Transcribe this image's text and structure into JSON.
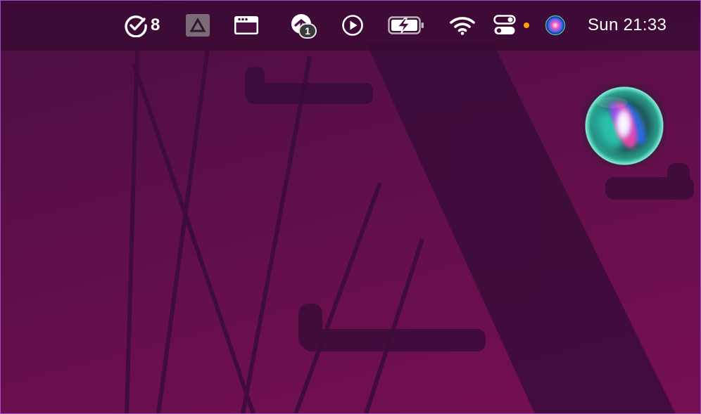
{
  "menubar": {
    "tasks": {
      "icon": "checkmark-circle-icon",
      "count": "8"
    },
    "items": [
      {
        "name": "drive-icon"
      },
      {
        "name": "window-icon"
      },
      {
        "name": "upload-cloud-icon",
        "badge": "1"
      },
      {
        "name": "play-icon"
      },
      {
        "name": "battery-charging-icon"
      },
      {
        "name": "wifi-icon"
      },
      {
        "name": "control-center-icon"
      },
      {
        "name": "siri-icon"
      }
    ],
    "status_dot_color": "#ff9f0a",
    "clock": "Sun 21:33"
  },
  "siri": {
    "state": "listening",
    "colors": [
      "#3be0c8",
      "#2a7bff",
      "#ff3fa8",
      "#ffffff"
    ]
  },
  "wallpaper": {
    "colors": [
      "#4a0f42",
      "#760f52"
    ],
    "shadow_color": "#3a0c36"
  }
}
